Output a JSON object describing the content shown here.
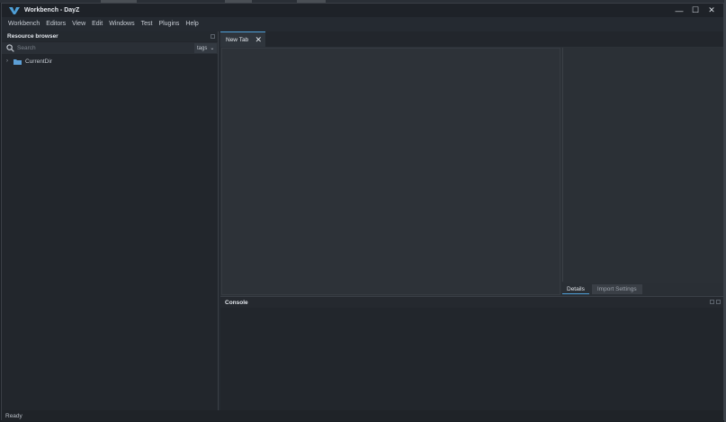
{
  "window": {
    "title": "Workbench - DayZ",
    "controls": {
      "minimize": "—",
      "maximize": "☐",
      "close": "✕"
    }
  },
  "menubar": {
    "items": [
      "Workbench",
      "Editors",
      "View",
      "Edit",
      "Windows",
      "Test",
      "Plugins",
      "Help"
    ]
  },
  "resource_browser": {
    "title": "Resource browser",
    "search_placeholder": "Search",
    "tags_label": "tags",
    "tree": [
      {
        "label": "CurrentDir",
        "icon": "folder-icon",
        "expanded": false
      }
    ]
  },
  "editor": {
    "tabs": [
      {
        "label": "New Tab",
        "active": true
      }
    ]
  },
  "details": {
    "tabs": [
      {
        "label": "Details",
        "active": true
      },
      {
        "label": "Import Settings",
        "active": false
      }
    ]
  },
  "console": {
    "title": "Console"
  },
  "status": {
    "text": "Ready"
  },
  "colors": {
    "accent": "#4fa0d8",
    "background": "#252a31"
  }
}
